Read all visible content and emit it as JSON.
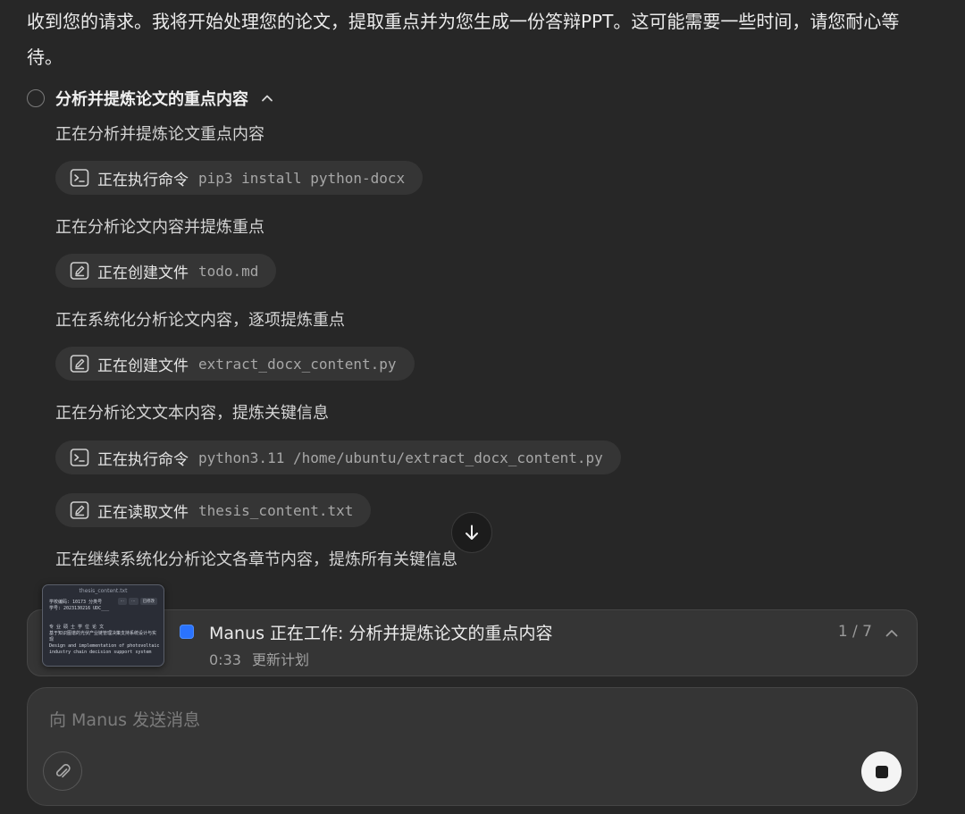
{
  "message": {
    "intro": "收到您的请求。我将开始处理您的论文，提取重点并为您生成一份答辩PPT。这可能需要一些时间，请您耐心等待。"
  },
  "task": {
    "title": "分析并提炼论文的重点内容",
    "icons": {
      "status": "circle-icon",
      "toggle": "chevron-up-icon"
    },
    "steps": [
      {
        "kind": "text",
        "text": "正在分析并提炼论文重点内容"
      },
      {
        "kind": "action",
        "icon": "terminal-icon",
        "action": "正在执行命令",
        "arg": "pip3 install python-docx"
      },
      {
        "kind": "text",
        "text": "正在分析论文内容并提炼重点"
      },
      {
        "kind": "action",
        "icon": "edit-icon",
        "action": "正在创建文件",
        "arg": "todo.md"
      },
      {
        "kind": "text",
        "text": "正在系统化分析论文内容，逐项提炼重点"
      },
      {
        "kind": "action",
        "icon": "edit-icon",
        "action": "正在创建文件",
        "arg": "extract_docx_content.py"
      },
      {
        "kind": "text",
        "text": "正在分析论文文本内容，提炼关键信息"
      },
      {
        "kind": "action",
        "icon": "terminal-icon",
        "action": "正在执行命令",
        "arg": "python3.11 /home/ubuntu/extract_docx_content.py"
      },
      {
        "kind": "action",
        "icon": "edit-icon",
        "action": "正在读取文件",
        "arg": "thesis_content.txt"
      },
      {
        "kind": "text",
        "text": "正在继续系统化分析论文各章节内容，提炼所有关键信息"
      }
    ]
  },
  "status": {
    "title": "Manus 正在工作: 分析并提炼论文的重点内容",
    "elapsed": "0:33",
    "sub": "更新计划",
    "progress": "1 / 7",
    "accent": "#2a73ff"
  },
  "thumbnail": {
    "title": "thesis_content.txt",
    "tabs": [
      "…",
      "…",
      "已修改"
    ],
    "lines": [
      "学校编码: 10173    分类号",
      "学号: 2023130216    UDC___",
      "",
      "",
      "专 业 硕 士 学 位 论 文",
      "基于知识图谱的光伏产业链管理决策支持系统设计与实现",
      "Design and implementation of photovoltaic",
      "industry chain decision support system"
    ]
  },
  "composer": {
    "placeholder": "向 Manus 发送消息",
    "icons": {
      "attach": "paperclip-icon",
      "stop": "stop-icon"
    }
  },
  "scroll": {
    "icon": "arrow-down-icon"
  }
}
